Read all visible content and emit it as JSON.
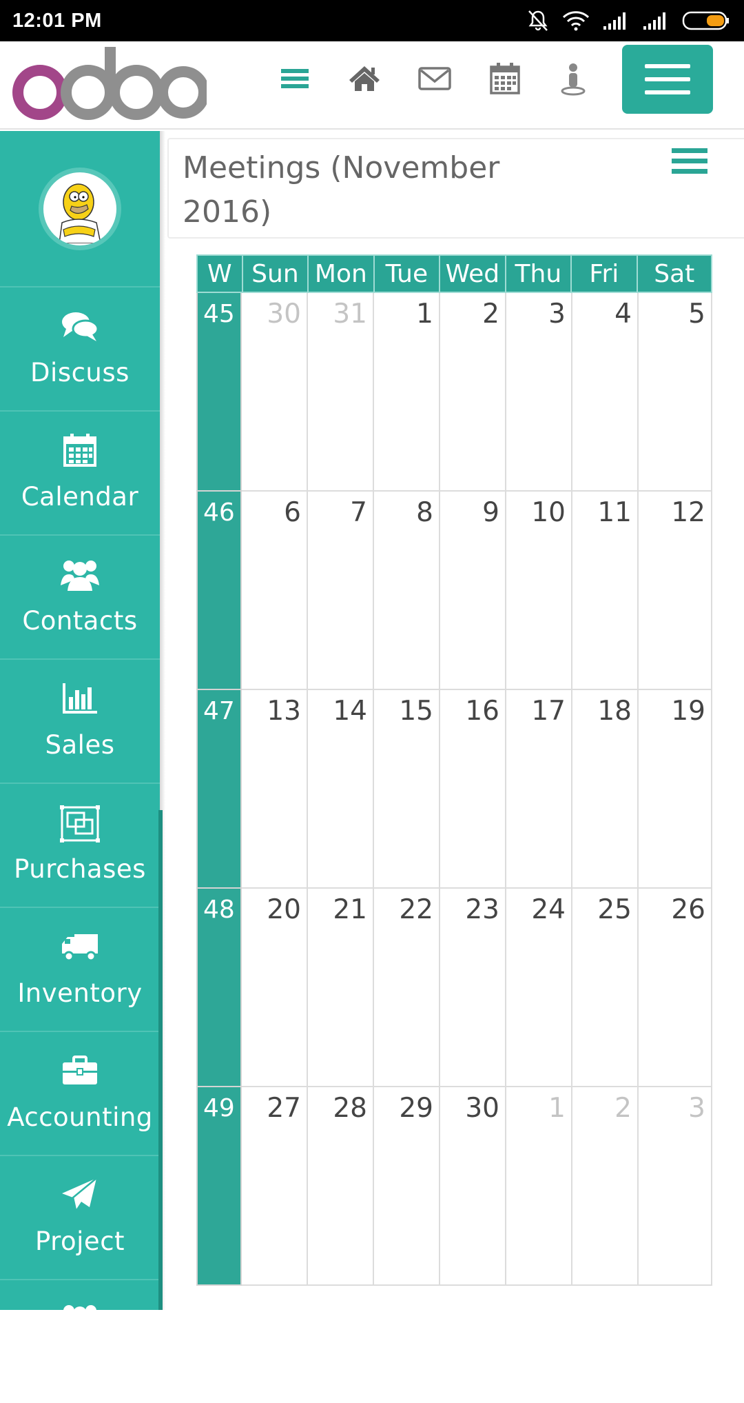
{
  "status_bar": {
    "time": "12:01 PM"
  },
  "colors": {
    "accent": "#2db6a6",
    "accent_dark": "#2aa595",
    "text": "#666666"
  },
  "topnav": {
    "logo_text": "odoo",
    "icons": [
      "list-icon",
      "home-icon",
      "mail-icon",
      "calendar-icon",
      "user-icon"
    ]
  },
  "sidebar": {
    "items": [
      {
        "label": "Discuss",
        "icon": "chat-bubbles-icon"
      },
      {
        "label": "Calendar",
        "icon": "calendar-icon"
      },
      {
        "label": "Contacts",
        "icon": "people-icon"
      },
      {
        "label": "Sales",
        "icon": "bar-chart-icon"
      },
      {
        "label": "Purchases",
        "icon": "purchases-icon"
      },
      {
        "label": "Inventory",
        "icon": "truck-icon"
      },
      {
        "label": "Accounting",
        "icon": "briefcase-icon"
      },
      {
        "label": "Project",
        "icon": "paper-plane-icon"
      }
    ]
  },
  "content": {
    "title": "Meetings (November 2016)"
  },
  "calendar": {
    "headers": [
      "W",
      "Sun",
      "Mon",
      "Tue",
      "Wed",
      "Thu",
      "Fri",
      "Sat"
    ],
    "weeks": [
      {
        "week": "45",
        "days": [
          {
            "d": "30",
            "other": true
          },
          {
            "d": "31",
            "other": true
          },
          {
            "d": "1"
          },
          {
            "d": "2"
          },
          {
            "d": "3"
          },
          {
            "d": "4"
          },
          {
            "d": "5"
          }
        ]
      },
      {
        "week": "46",
        "days": [
          {
            "d": "6"
          },
          {
            "d": "7"
          },
          {
            "d": "8"
          },
          {
            "d": "9"
          },
          {
            "d": "10"
          },
          {
            "d": "11"
          },
          {
            "d": "12"
          }
        ]
      },
      {
        "week": "47",
        "days": [
          {
            "d": "13"
          },
          {
            "d": "14"
          },
          {
            "d": "15"
          },
          {
            "d": "16"
          },
          {
            "d": "17"
          },
          {
            "d": "18"
          },
          {
            "d": "19"
          }
        ]
      },
      {
        "week": "48",
        "days": [
          {
            "d": "20"
          },
          {
            "d": "21"
          },
          {
            "d": "22"
          },
          {
            "d": "23"
          },
          {
            "d": "24"
          },
          {
            "d": "25"
          },
          {
            "d": "26"
          }
        ]
      },
      {
        "week": "49",
        "days": [
          {
            "d": "27"
          },
          {
            "d": "28"
          },
          {
            "d": "29"
          },
          {
            "d": "30"
          },
          {
            "d": "1",
            "other": true
          },
          {
            "d": "2",
            "other": true
          },
          {
            "d": "3",
            "other": true
          }
        ]
      }
    ]
  }
}
